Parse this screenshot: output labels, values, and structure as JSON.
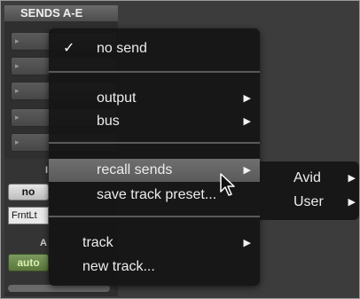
{
  "strip": {
    "header": "SENDS A-E",
    "slot_count": 5,
    "lower_labels": {
      "pan_label": "I",
      "auto_label": "A"
    },
    "no_button": "no",
    "output_button": "FrntLt",
    "auto_button": "auto"
  },
  "menu": {
    "items": [
      {
        "label": "no send",
        "checked": true,
        "submenu": false
      },
      {
        "label": "output",
        "submenu": true
      },
      {
        "label": "bus",
        "submenu": true
      },
      {
        "label": "recall sends",
        "submenu": true,
        "highlighted": true
      },
      {
        "label": "save track preset...",
        "submenu": false
      },
      {
        "label": "track",
        "submenu": true
      },
      {
        "label": "new track...",
        "submenu": false
      }
    ]
  },
  "submenu": {
    "items": [
      {
        "label": "Avid",
        "submenu": true
      },
      {
        "label": "User",
        "submenu": true
      }
    ]
  },
  "icons": {
    "check": "checkmark-icon",
    "arrow": "submenu-arrow-icon",
    "cursor": "mouse-cursor-icon"
  }
}
